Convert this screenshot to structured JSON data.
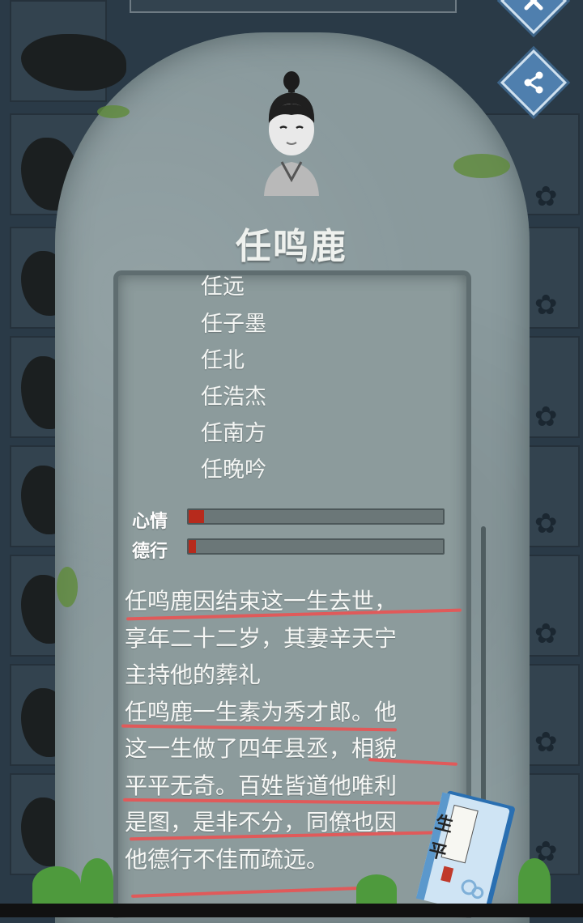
{
  "person": {
    "name": "任鸣鹿"
  },
  "children": [
    "任远",
    "任子墨",
    "任北",
    "任浩杰",
    "任南方",
    "任晚吟"
  ],
  "stats": {
    "mood": {
      "label": "心情",
      "level": 0.06
    },
    "virtue": {
      "label": "德行",
      "level": 0.03
    }
  },
  "biography": {
    "lines": [
      "任鸣鹿因结束这一生去世，",
      "享年二十二岁，其妻辛天宁",
      "主持他的葬礼",
      "任鸣鹿一生素为秀才郎。他",
      "这一生做了四年县丞，相貌",
      "平平无奇。百姓皆道他唯利",
      "是图，是非不分，同僚也因",
      "他德行不佳而疏远。"
    ]
  },
  "book": {
    "title_glyph_1": "生",
    "title_glyph_2": "平"
  },
  "colors": {
    "stone": "#8a9a9d",
    "bar_fill": "#b72a1c",
    "underline": "#e05a5a",
    "button": "#4f7fae"
  },
  "icons": {
    "close": "close-icon",
    "share": "share-icon",
    "flower": "plum-blossom-icon"
  }
}
